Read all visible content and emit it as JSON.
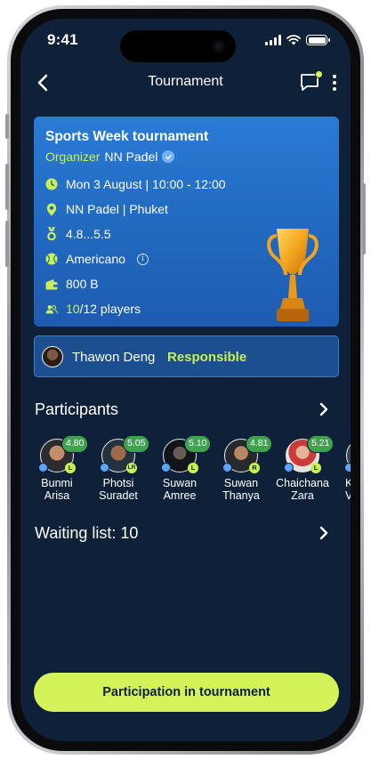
{
  "status_bar": {
    "time": "9:41"
  },
  "nav": {
    "title": "Tournament"
  },
  "tournament": {
    "title": "Sports Week tournament",
    "organizer_label": "Organizer",
    "organizer_name": "NN Padel",
    "date_time": "Mon 3 August | 10:00 - 12:00",
    "location": "NN Padel | Phuket",
    "level_range": "4.8...5.5",
    "format": "Americano",
    "price": "800 B",
    "players_current": "10",
    "players_total": "/12 players"
  },
  "responsible": {
    "name": "Thawon Deng",
    "tag": "Responsible"
  },
  "participants": {
    "heading": "Participants",
    "items": [
      {
        "first": "Bunmi",
        "last": "Arisa",
        "rating": "4.80",
        "level": "L"
      },
      {
        "first": "Photsi",
        "last": "Suradet",
        "rating": "5.05",
        "level": "LR"
      },
      {
        "first": "Suwan",
        "last": "Amree",
        "rating": "5.10",
        "level": "L"
      },
      {
        "first": "Suwan",
        "last": "Thanya",
        "rating": "4.81",
        "level": "R"
      },
      {
        "first": "Chaichana",
        "last": "Zara",
        "rating": "5.21",
        "level": "L"
      },
      {
        "first": "K",
        "last": "V",
        "rating": "",
        "level": ""
      }
    ]
  },
  "waiting_list": {
    "label": "Waiting list: 10"
  },
  "cta": {
    "label": "Participation in tournament"
  },
  "colors": {
    "background": "#0f2138",
    "accent": "#c9ef57",
    "card": "#2a7bd5",
    "cta": "#d4f35a"
  }
}
